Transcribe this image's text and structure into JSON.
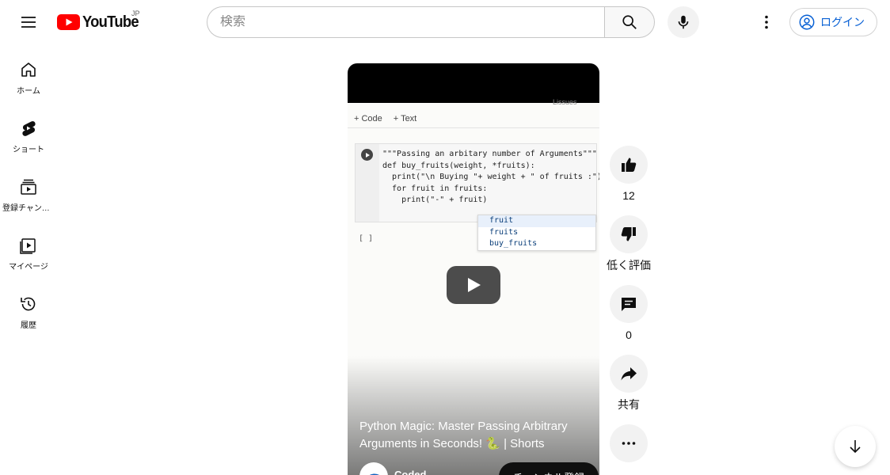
{
  "header": {
    "logo_text": "YouTube",
    "country_code": "JP",
    "search_placeholder": "検索",
    "login_label": "ログイン"
  },
  "sidebar": {
    "items": [
      {
        "label": "ホーム",
        "icon": "home-icon"
      },
      {
        "label": "ショート",
        "icon": "shorts-icon"
      },
      {
        "label": "登録チャンネル",
        "icon": "subscriptions-icon"
      },
      {
        "label": "マイページ",
        "icon": "library-icon"
      },
      {
        "label": "履歴",
        "icon": "history-icon"
      }
    ]
  },
  "video": {
    "title": "Python Magic: Master Passing Arbitrary Arguments in Seconds! 🐍 | Shorts",
    "channel_name": "Coded...",
    "subscribe_label": "チャンネル登録",
    "notebook": {
      "toolbar": [
        "+ Code",
        "+ Text"
      ],
      "top_clip": "Lissues",
      "code_lines": [
        "\"\"\"Passing an arbitary number of Arguments\"\"\"",
        "def buy_fruits(weight, *fruits):",
        "  print(\"\\n Buying \"+ weight + \" of fruits :\")",
        "",
        "  for fruit in fruits:",
        "    print(\"-\" + fruit)"
      ],
      "empty_cell": "[ ]",
      "suggestions": [
        "fruit",
        "fruits",
        "buy_fruits"
      ]
    }
  },
  "actions": {
    "like_count": "12",
    "dislike_label": "低く評価",
    "comment_count": "0",
    "share_label": "共有"
  },
  "colors": {
    "brand_red": "#ff0000",
    "link_blue": "#065fd4"
  }
}
